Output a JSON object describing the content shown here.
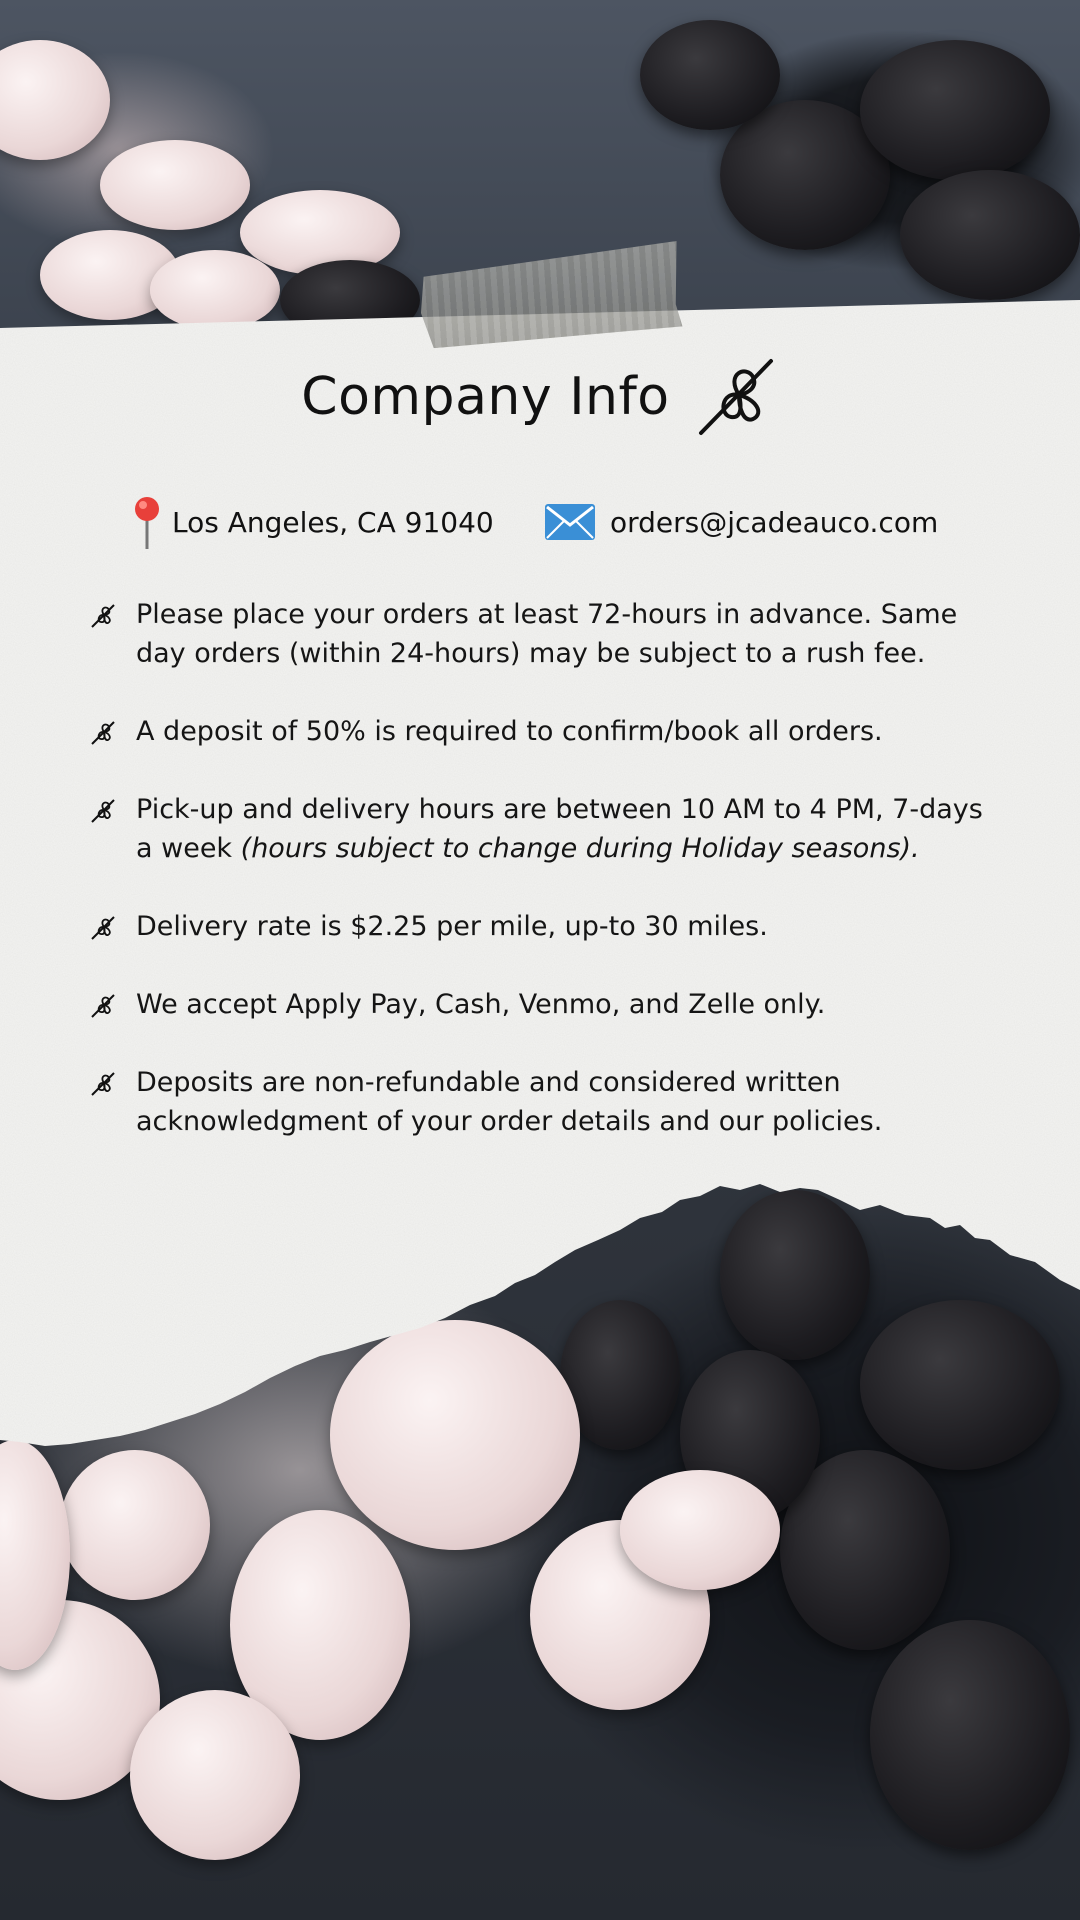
{
  "title": "Company Info",
  "contact": {
    "location": "Los Angeles, CA 91040",
    "email": "orders@jcadeauco.com"
  },
  "icons": {
    "title": "whisk-icon",
    "location": "pin-icon",
    "email": "envelope-icon",
    "bullet": "whisk-icon"
  },
  "rules": [
    {
      "text": "Please place your orders at least 72-hours in advance. Same day orders (within 24-hours) may be subject to a rush fee."
    },
    {
      "text": "A deposit of 50% is required to confirm/book all orders."
    },
    {
      "text": "Pick-up and delivery hours are between 10 AM to 4 PM, 7-days a week ",
      "note": "(hours subject to change during Holiday seasons)."
    },
    {
      "text": "Delivery rate is $2.25 per mile, up-to 30 miles."
    },
    {
      "text": "We accept Apply Pay, Cash, Venmo, and Zelle only."
    },
    {
      "text": "Deposits are non-refundable and considered written acknowledgment of your order details and our policies."
    }
  ],
  "colors": {
    "paper": "#f4f4f2",
    "text": "#111111",
    "pin": "#e8403a",
    "mail": "#3a8fd6"
  }
}
